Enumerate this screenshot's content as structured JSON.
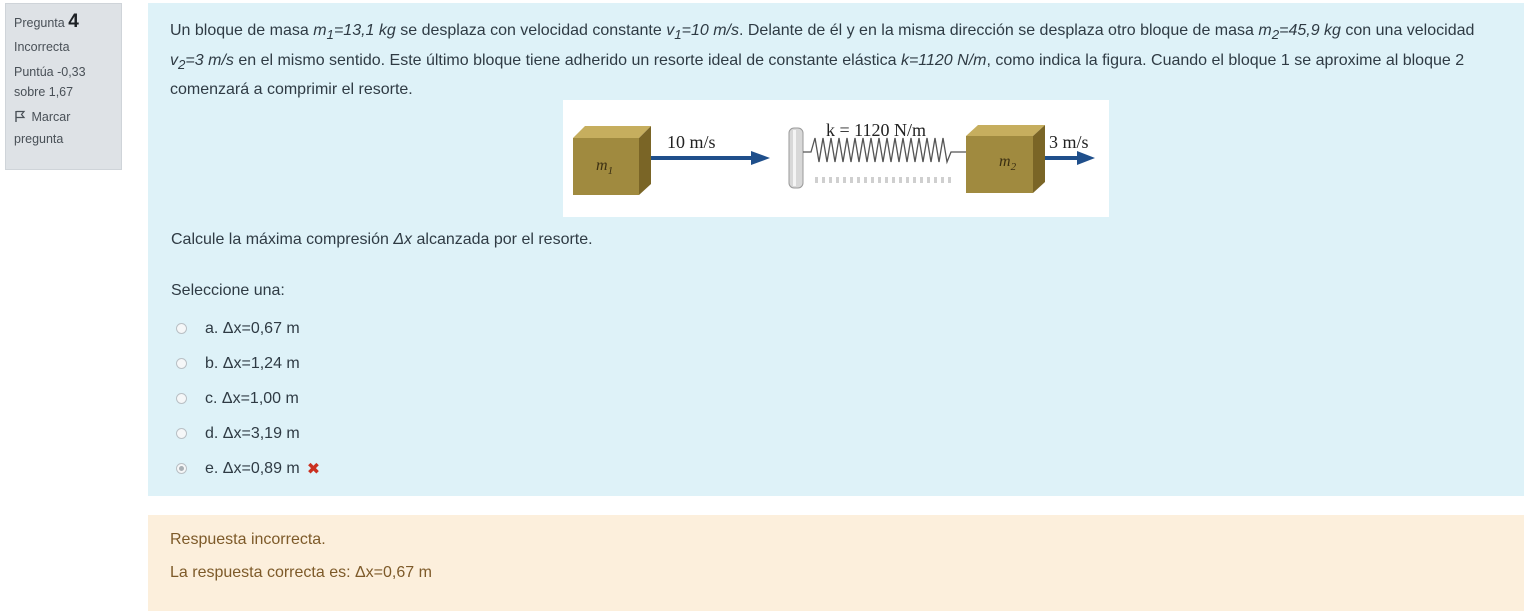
{
  "info": {
    "question_label": "Pregunta",
    "question_number": "4",
    "state": "Incorrecta",
    "grade_line1": "Puntúa -0,33",
    "grade_line2": "sobre 1,67",
    "flag_line1": "Marcar",
    "flag_line2": "pregunta"
  },
  "question": {
    "t1": "Un bloque de masa ",
    "m1_sym": "m",
    "m1_sub": "1",
    "m1_val": "=13,1 kg",
    "t2": " se desplaza con velocidad constante ",
    "v1_sym": "v",
    "v1_sub": "1",
    "v1_val": "=10 m/s",
    "t3": ". Delante de él y en la misma dirección se desplaza otro bloque de masa ",
    "m2_sym": "m",
    "m2_sub": "2",
    "m2_val": "=45,9 kg",
    "t4": " con una velocidad ",
    "v2_sym": "v",
    "v2_sub": "2",
    "v2_val": "=3 m/s",
    "t5": " en el mismo sentido. Este último bloque tiene adherido un resorte ideal de constante elástica ",
    "k_val": "k=1120 N/m",
    "t6": ", como indica la figura. Cuando el bloque 1 se aproxime al bloque 2 comenzará a comprimir el resorte.",
    "prompt_t1": "Calcule la máxima compresión ",
    "prompt_dx": "Δx",
    "prompt_t2": " alcanzada por el resorte.",
    "select_label": "Seleccione una:"
  },
  "figure": {
    "v1_label": "10 m/s",
    "k_label": "k = 1120 N/m",
    "v2_label": "3 m/s",
    "m1_label": "m",
    "m1_sub": "1",
    "m2_label": "m",
    "m2_sub": "2"
  },
  "answers": [
    {
      "text": "a. Δx=0,67 m",
      "checked": false
    },
    {
      "text": "b. Δx=1,24 m",
      "checked": false
    },
    {
      "text": "c. Δx=1,00 m",
      "checked": false
    },
    {
      "text": "d. Δx=3,19 m",
      "checked": false
    },
    {
      "text": "e. Δx=0,89 m",
      "checked": true,
      "mark": "✖"
    }
  ],
  "feedback": {
    "result": "Respuesta incorrecta.",
    "correct": "La respuesta correcta es: Δx=0,67 m"
  },
  "colors": {
    "formulation_bg": "#def2f8",
    "outcome_bg": "#fcefdc",
    "info_bg": "#dee2e6",
    "arrow": "#1f4f8b",
    "block": "#a08a3f",
    "incorrect": "#ca3120"
  },
  "icons": {
    "flag": "flag-icon",
    "incorrect_mark": "cross-icon"
  }
}
